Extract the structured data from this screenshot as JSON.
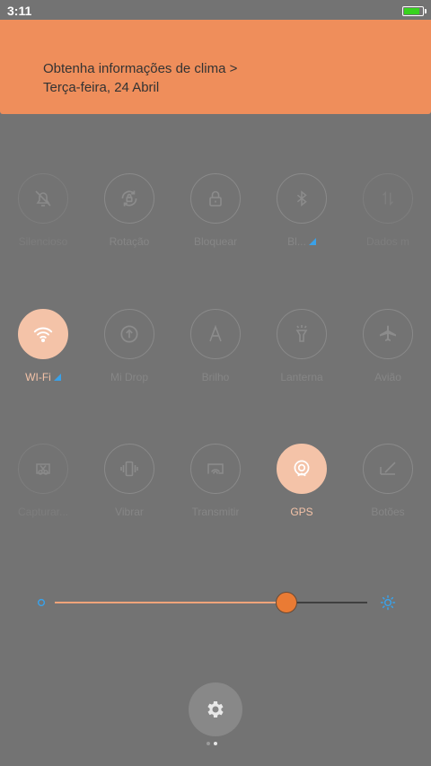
{
  "status": {
    "time": "3:11",
    "battery_level": 0.9
  },
  "weather": {
    "line1": "Obtenha informações de clima >",
    "line2": "Terça-feira, 24 Abril"
  },
  "toggles": [
    {
      "label": "Silencioso",
      "icon": "bell-off-icon",
      "state": "dim"
    },
    {
      "label": "Rotação",
      "icon": "rotation-lock-icon",
      "state": "off"
    },
    {
      "label": "Bloquear",
      "icon": "lock-icon",
      "state": "off"
    },
    {
      "label": "Bl...",
      "icon": "bluetooth-icon",
      "state": "off"
    },
    {
      "label": "Dados m",
      "icon": "mobile-data-icon",
      "state": "dim"
    },
    {
      "label": "WI-Fi",
      "icon": "wifi-icon",
      "state": "active"
    },
    {
      "label": "Mi Drop",
      "icon": "mi-drop-icon",
      "state": "off"
    },
    {
      "label": "Brilho",
      "icon": "auto-brightness-icon",
      "state": "off"
    },
    {
      "label": "Lanterna",
      "icon": "flashlight-icon",
      "state": "off"
    },
    {
      "label": "Avião",
      "icon": "airplane-icon",
      "state": "off"
    },
    {
      "label": "Capturar...",
      "icon": "screenshot-icon",
      "state": "dim"
    },
    {
      "label": "Vibrar",
      "icon": "vibrate-icon",
      "state": "off"
    },
    {
      "label": "Transmitir",
      "icon": "cast-icon",
      "state": "off"
    },
    {
      "label": "GPS",
      "icon": "gps-icon",
      "state": "active"
    },
    {
      "label": "Botões",
      "icon": "buttons-icon",
      "state": "off"
    }
  ],
  "brightness": {
    "level": 0.74
  },
  "colors": {
    "accent": "#ef8e5b",
    "active_tile": "#f4c3a8",
    "thumb": "#ea7b34",
    "indicator": "#3aa1e8"
  }
}
